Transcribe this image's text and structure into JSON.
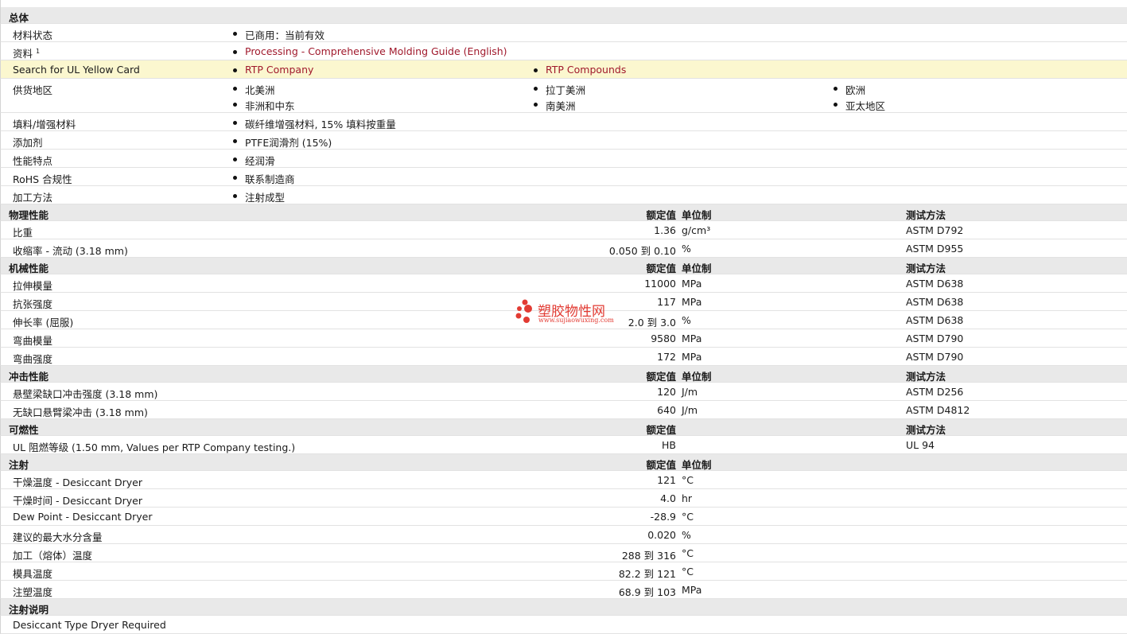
{
  "general": {
    "title": "总体",
    "material_status": {
      "label": "材料状态",
      "value": "已商用：当前有效"
    },
    "info": {
      "label": "资料",
      "sup": "1",
      "link": "Processing - Comprehensive Molding Guide (English)"
    },
    "ul": {
      "label": "Search for UL Yellow Card",
      "links": [
        "RTP Company",
        "RTP Compounds"
      ]
    },
    "regions": {
      "label": "供货地区",
      "items": [
        "北美洲",
        "拉丁美洲",
        "欧洲",
        "非洲和中东",
        "南美洲",
        "亚太地区"
      ]
    },
    "filler": {
      "label": "填料/增强材料",
      "value": "碳纤维增强材料, 15% 填料按重量"
    },
    "additive": {
      "label": "添加剂",
      "value": "PTFE润滑剂 (15%)"
    },
    "features": {
      "label": "性能特点",
      "value": "经润滑"
    },
    "rohs": {
      "label": "RoHS 合规性",
      "value": "联系制造商"
    },
    "processing": {
      "label": "加工方法",
      "value": "注射成型"
    }
  },
  "physical": {
    "title": "物理性能",
    "h_val": "额定值",
    "h_unit": "单位制",
    "h_test": "测试方法",
    "rows": [
      {
        "label": "比重",
        "value": "1.36",
        "unit": "g/cm³",
        "test": "ASTM D792"
      },
      {
        "label": "收缩率  - 流动  (3.18 mm)",
        "value": "0.050 到  0.10",
        "unit": "%",
        "test": "ASTM D955"
      }
    ]
  },
  "mechanical": {
    "title": "机械性能",
    "h_val": "额定值",
    "h_unit": "单位制",
    "h_test": "测试方法",
    "rows": [
      {
        "label": "拉伸模量",
        "value": "11000",
        "unit": "MPa",
        "test": "ASTM D638"
      },
      {
        "label": "抗张强度",
        "value": "117",
        "unit": "MPa",
        "test": "ASTM D638"
      },
      {
        "label": "伸长率  (屈服)",
        "value": "2.0 到  3.0",
        "unit": "%",
        "test": "ASTM D638"
      },
      {
        "label": "弯曲模量",
        "value": "9580",
        "unit": "MPa",
        "test": "ASTM D790"
      },
      {
        "label": "弯曲强度",
        "value": "172",
        "unit": "MPa",
        "test": "ASTM D790"
      }
    ]
  },
  "impact": {
    "title": "冲击性能",
    "h_val": "额定值",
    "h_unit": "单位制",
    "h_test": "测试方法",
    "rows": [
      {
        "label": "悬壁梁缺口冲击强度  (3.18 mm)",
        "value": "120",
        "unit": "J/m",
        "test": "ASTM D256"
      },
      {
        "label": "无缺口悬臂梁冲击  (3.18 mm)",
        "value": "640",
        "unit": "J/m",
        "test": "ASTM D4812"
      }
    ]
  },
  "flammability": {
    "title": "可燃性",
    "h_val": "额定值",
    "h_test": "测试方法",
    "rows": [
      {
        "label": "UL 阻燃等级  (1.50 mm, Values per RTP Company testing.)",
        "value": "HB",
        "unit": "",
        "test": "UL 94"
      }
    ]
  },
  "injection": {
    "title": "注射",
    "h_val": "额定值",
    "h_unit": "单位制",
    "rows": [
      {
        "label": "干燥温度  - Desiccant Dryer",
        "value": "121",
        "unit": "°C"
      },
      {
        "label": "干燥时间  - Desiccant Dryer",
        "value": "4.0",
        "unit": "hr"
      },
      {
        "label": "Dew Point - Desiccant Dryer",
        "value": "-28.9",
        "unit": "°C"
      },
      {
        "label": "建议的最大水分含量",
        "value": "0.020",
        "unit": "%"
      },
      {
        "label": "加工（熔体）温度",
        "value": "288 到  316",
        "unit": "°C"
      },
      {
        "label": "模具温度",
        "value": "82.2 到  121",
        "unit": "°C"
      },
      {
        "label": "注塑温度",
        "value": "68.9 到  103",
        "unit": "MPa"
      }
    ]
  },
  "notes": {
    "title": "注射说明",
    "text": "Desiccant Type Dryer Required"
  },
  "watermark": {
    "text": "塑胶物性网",
    "url": "www.sujiaowuxing.com",
    "color": "#e23b33"
  }
}
